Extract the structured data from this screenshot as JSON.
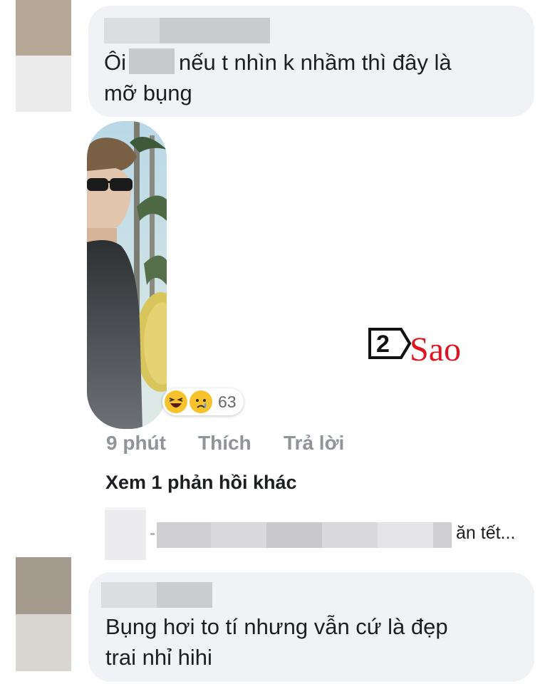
{
  "comments": [
    {
      "text_before": "Ôi",
      "text_after": "nếu t nhìn k nhầm thì đây là",
      "text_line2": "mỡ bụng"
    },
    {
      "text_line1": "Bụng hơi to tí nhưng vẫn cứ là đẹp",
      "text_line2": "trai nhỉ hihi"
    }
  ],
  "reactions": {
    "icons": [
      "laughing-emoji",
      "crying-emoji"
    ],
    "count": "63"
  },
  "actions": {
    "time": "9 phút",
    "like": "Thích",
    "reply": "Trả lời"
  },
  "view_more": "Xem 1 phản hồi khác",
  "reply_preview": {
    "tail": "ăn tết..."
  },
  "watermark": {
    "digit": "2",
    "text": "Sao"
  },
  "colors": {
    "bubble": "#f0f2f5",
    "meta_text": "#909398",
    "watermark_red": "#e0141e"
  }
}
